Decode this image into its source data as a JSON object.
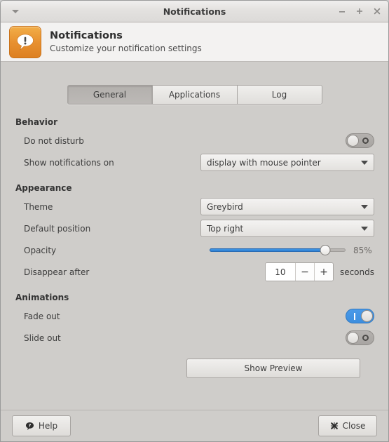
{
  "window": {
    "title": "Notifications",
    "menu_icon": "chevron-down-icon",
    "buttons": [
      {
        "name": "minimize",
        "glyph": "−"
      },
      {
        "name": "maximize",
        "glyph": "+"
      },
      {
        "name": "close",
        "glyph": "✕"
      }
    ]
  },
  "header": {
    "icon": "notification-bubble-icon",
    "title": "Notifications",
    "subtitle": "Customize your notification settings"
  },
  "tabs": [
    {
      "label": "General",
      "active": true
    },
    {
      "label": "Applications",
      "active": false
    },
    {
      "label": "Log",
      "active": false
    }
  ],
  "sections": {
    "behavior": {
      "title": "Behavior",
      "do_not_disturb": {
        "label": "Do not disturb",
        "state": "off"
      },
      "show_notifications_on": {
        "label": "Show notifications on",
        "value": "display with mouse pointer"
      }
    },
    "appearance": {
      "title": "Appearance",
      "theme": {
        "label": "Theme",
        "value": "Greybird"
      },
      "default_position": {
        "label": "Default position",
        "value": "Top right"
      },
      "opacity": {
        "label": "Opacity",
        "value": 85,
        "value_text": "85%",
        "min": 0,
        "max": 100
      },
      "disappear_after": {
        "label": "Disappear after",
        "value": "10",
        "decrement": "−",
        "increment": "+",
        "suffix": "seconds"
      }
    },
    "animations": {
      "title": "Animations",
      "fade_out": {
        "label": "Fade out",
        "state": "on"
      },
      "slide_out": {
        "label": "Slide out",
        "state": "off"
      }
    }
  },
  "preview_button": {
    "label": "Show Preview"
  },
  "footer": {
    "help": {
      "label": "Help",
      "icon": "help-bubble-icon"
    },
    "close": {
      "label": "Close",
      "icon": "close-x-icon"
    }
  },
  "colors": {
    "accent_blue": "#3d8ede",
    "icon_orange": "#e89130",
    "window_bg": "#cfcdca",
    "header_bg": "#f3f2f1"
  }
}
